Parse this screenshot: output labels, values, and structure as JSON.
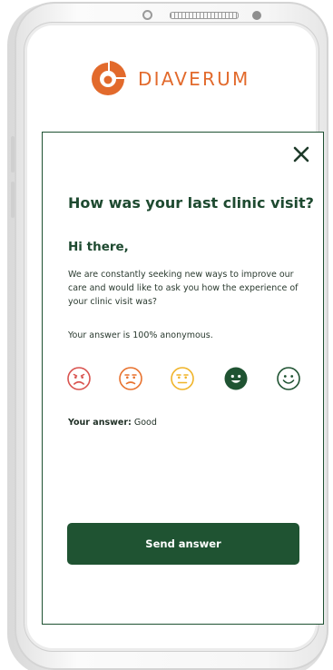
{
  "brand": {
    "name": "DIAVERUM",
    "color": "#e26a2c"
  },
  "survey": {
    "title": "How was your last clinic visit?",
    "greeting": "Hi there,",
    "intro": "We are constantly seeking new ways to improve our care and would like to ask you how the experience of your clinic visit was?",
    "anonymity_note": "Your answer is 100% anonymous.",
    "ratings": [
      {
        "level": "very-bad",
        "icon": "frown-icon",
        "color": "#d9534f",
        "selected": false
      },
      {
        "level": "bad",
        "icon": "slight-frown-icon",
        "color": "#e8722e",
        "selected": false
      },
      {
        "level": "neutral",
        "icon": "neutral-face-icon",
        "color": "#f0b429",
        "selected": false
      },
      {
        "level": "good",
        "icon": "smile-icon",
        "color": "#1f5332",
        "selected": true
      },
      {
        "level": "very-good",
        "icon": "big-smile-icon",
        "color": "#1f5332",
        "selected": false
      }
    ],
    "answer_label": "Your answer:",
    "answer_value": "Good",
    "send_label": "Send answer",
    "accent": "#1f5332"
  }
}
